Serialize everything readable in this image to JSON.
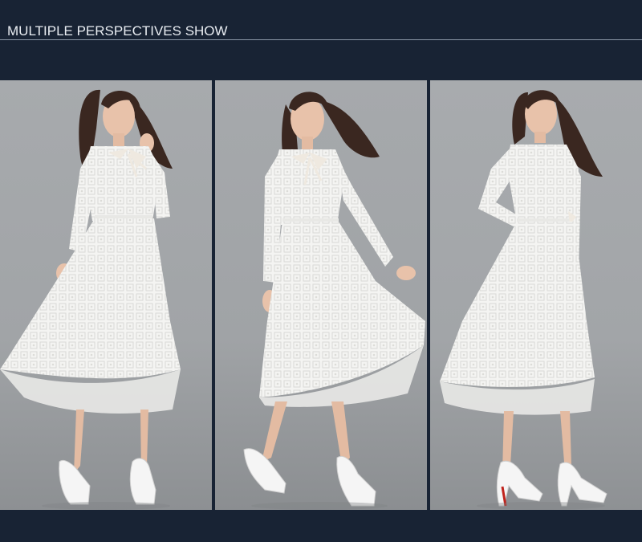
{
  "header": {
    "title": "MULTIPLE PERSPECTIVES SHOW"
  },
  "colors": {
    "background": "#182334",
    "backdrop": "#9fa2a5",
    "dress": "#f3f3f1",
    "hair": "#3a2720",
    "skin": "#e8c2aa",
    "shoe": "#f5f5f5",
    "sole_accent": "#c0231c"
  },
  "panels": [
    {
      "view": "front"
    },
    {
      "view": "front-walking"
    },
    {
      "view": "back"
    }
  ]
}
